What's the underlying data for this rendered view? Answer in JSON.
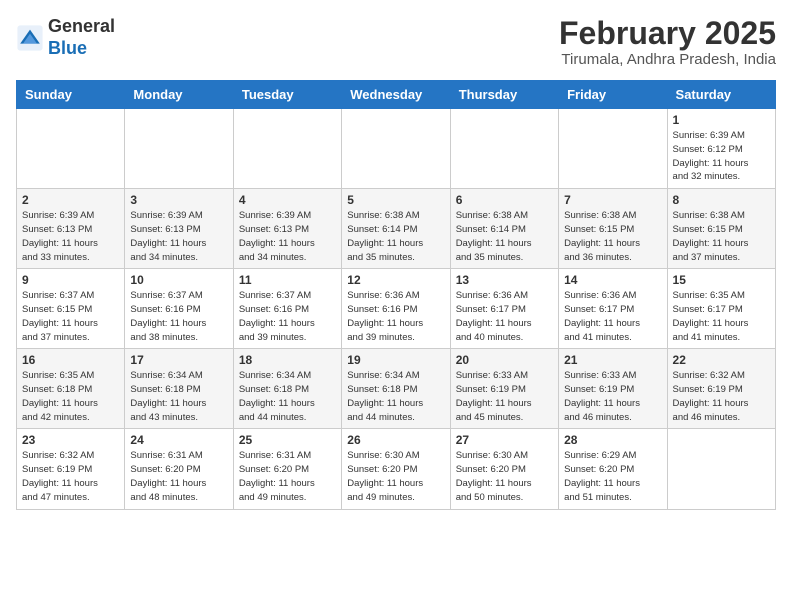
{
  "header": {
    "logo_general": "General",
    "logo_blue": "Blue",
    "month_year": "February 2025",
    "location": "Tirumala, Andhra Pradesh, India"
  },
  "days_of_week": [
    "Sunday",
    "Monday",
    "Tuesday",
    "Wednesday",
    "Thursday",
    "Friday",
    "Saturday"
  ],
  "weeks": [
    [
      {
        "day": "",
        "info": ""
      },
      {
        "day": "",
        "info": ""
      },
      {
        "day": "",
        "info": ""
      },
      {
        "day": "",
        "info": ""
      },
      {
        "day": "",
        "info": ""
      },
      {
        "day": "",
        "info": ""
      },
      {
        "day": "1",
        "info": "Sunrise: 6:39 AM\nSunset: 6:12 PM\nDaylight: 11 hours\nand 32 minutes."
      }
    ],
    [
      {
        "day": "2",
        "info": "Sunrise: 6:39 AM\nSunset: 6:13 PM\nDaylight: 11 hours\nand 33 minutes."
      },
      {
        "day": "3",
        "info": "Sunrise: 6:39 AM\nSunset: 6:13 PM\nDaylight: 11 hours\nand 34 minutes."
      },
      {
        "day": "4",
        "info": "Sunrise: 6:39 AM\nSunset: 6:13 PM\nDaylight: 11 hours\nand 34 minutes."
      },
      {
        "day": "5",
        "info": "Sunrise: 6:38 AM\nSunset: 6:14 PM\nDaylight: 11 hours\nand 35 minutes."
      },
      {
        "day": "6",
        "info": "Sunrise: 6:38 AM\nSunset: 6:14 PM\nDaylight: 11 hours\nand 35 minutes."
      },
      {
        "day": "7",
        "info": "Sunrise: 6:38 AM\nSunset: 6:15 PM\nDaylight: 11 hours\nand 36 minutes."
      },
      {
        "day": "8",
        "info": "Sunrise: 6:38 AM\nSunset: 6:15 PM\nDaylight: 11 hours\nand 37 minutes."
      }
    ],
    [
      {
        "day": "9",
        "info": "Sunrise: 6:37 AM\nSunset: 6:15 PM\nDaylight: 11 hours\nand 37 minutes."
      },
      {
        "day": "10",
        "info": "Sunrise: 6:37 AM\nSunset: 6:16 PM\nDaylight: 11 hours\nand 38 minutes."
      },
      {
        "day": "11",
        "info": "Sunrise: 6:37 AM\nSunset: 6:16 PM\nDaylight: 11 hours\nand 39 minutes."
      },
      {
        "day": "12",
        "info": "Sunrise: 6:36 AM\nSunset: 6:16 PM\nDaylight: 11 hours\nand 39 minutes."
      },
      {
        "day": "13",
        "info": "Sunrise: 6:36 AM\nSunset: 6:17 PM\nDaylight: 11 hours\nand 40 minutes."
      },
      {
        "day": "14",
        "info": "Sunrise: 6:36 AM\nSunset: 6:17 PM\nDaylight: 11 hours\nand 41 minutes."
      },
      {
        "day": "15",
        "info": "Sunrise: 6:35 AM\nSunset: 6:17 PM\nDaylight: 11 hours\nand 41 minutes."
      }
    ],
    [
      {
        "day": "16",
        "info": "Sunrise: 6:35 AM\nSunset: 6:18 PM\nDaylight: 11 hours\nand 42 minutes."
      },
      {
        "day": "17",
        "info": "Sunrise: 6:34 AM\nSunset: 6:18 PM\nDaylight: 11 hours\nand 43 minutes."
      },
      {
        "day": "18",
        "info": "Sunrise: 6:34 AM\nSunset: 6:18 PM\nDaylight: 11 hours\nand 44 minutes."
      },
      {
        "day": "19",
        "info": "Sunrise: 6:34 AM\nSunset: 6:18 PM\nDaylight: 11 hours\nand 44 minutes."
      },
      {
        "day": "20",
        "info": "Sunrise: 6:33 AM\nSunset: 6:19 PM\nDaylight: 11 hours\nand 45 minutes."
      },
      {
        "day": "21",
        "info": "Sunrise: 6:33 AM\nSunset: 6:19 PM\nDaylight: 11 hours\nand 46 minutes."
      },
      {
        "day": "22",
        "info": "Sunrise: 6:32 AM\nSunset: 6:19 PM\nDaylight: 11 hours\nand 46 minutes."
      }
    ],
    [
      {
        "day": "23",
        "info": "Sunrise: 6:32 AM\nSunset: 6:19 PM\nDaylight: 11 hours\nand 47 minutes."
      },
      {
        "day": "24",
        "info": "Sunrise: 6:31 AM\nSunset: 6:20 PM\nDaylight: 11 hours\nand 48 minutes."
      },
      {
        "day": "25",
        "info": "Sunrise: 6:31 AM\nSunset: 6:20 PM\nDaylight: 11 hours\nand 49 minutes."
      },
      {
        "day": "26",
        "info": "Sunrise: 6:30 AM\nSunset: 6:20 PM\nDaylight: 11 hours\nand 49 minutes."
      },
      {
        "day": "27",
        "info": "Sunrise: 6:30 AM\nSunset: 6:20 PM\nDaylight: 11 hours\nand 50 minutes."
      },
      {
        "day": "28",
        "info": "Sunrise: 6:29 AM\nSunset: 6:20 PM\nDaylight: 11 hours\nand 51 minutes."
      },
      {
        "day": "",
        "info": ""
      }
    ]
  ]
}
